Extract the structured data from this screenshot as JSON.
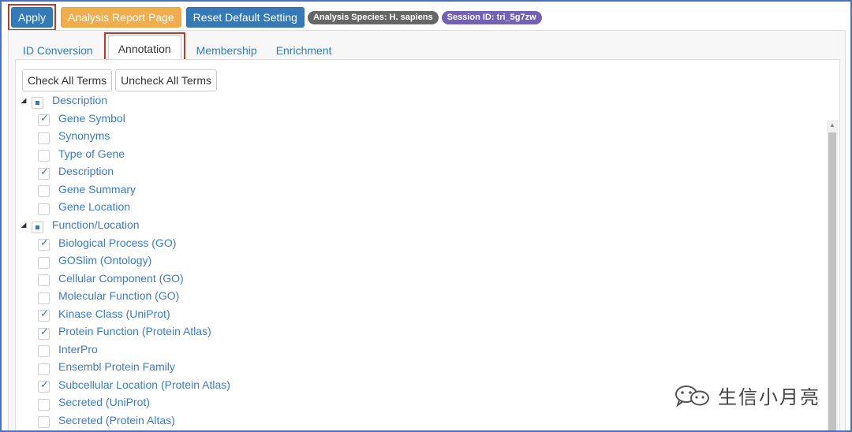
{
  "toolbar": {
    "apply_label": "Apply",
    "report_label": "Analysis Report Page",
    "reset_label": "Reset Default Setting",
    "species_badge": "Analysis Species: H. sapiens",
    "session_badge": "Session ID: tri_5g7zw"
  },
  "tabs": [
    {
      "label": "ID Conversion",
      "active": false
    },
    {
      "label": "Annotation",
      "active": true
    },
    {
      "label": "Membership",
      "active": false
    },
    {
      "label": "Enrichment",
      "active": false
    }
  ],
  "actions": {
    "check_all_label": "Check All Terms",
    "uncheck_all_label": "Uncheck All Terms"
  },
  "tree": [
    {
      "label": "Description",
      "state": "partial",
      "children": [
        {
          "label": "Gene Symbol",
          "checked": true
        },
        {
          "label": "Synonyms",
          "checked": false
        },
        {
          "label": "Type of Gene",
          "checked": false
        },
        {
          "label": "Description",
          "checked": true
        },
        {
          "label": "Gene Summary",
          "checked": false
        },
        {
          "label": "Gene Location",
          "checked": false
        }
      ]
    },
    {
      "label": "Function/Location",
      "state": "partial",
      "children": [
        {
          "label": "Biological Process (GO)",
          "checked": true
        },
        {
          "label": "GOSlim (Ontology)",
          "checked": false
        },
        {
          "label": "Cellular Component (GO)",
          "checked": false
        },
        {
          "label": "Molecular Function (GO)",
          "checked": false
        },
        {
          "label": "Kinase Class (UniProt)",
          "checked": true
        },
        {
          "label": "Protein Function (Protein Atlas)",
          "checked": true
        },
        {
          "label": "InterPro",
          "checked": false
        },
        {
          "label": "Ensembl Protein Family",
          "checked": false
        },
        {
          "label": "Subcellular Location (Protein Atlas)",
          "checked": true
        },
        {
          "label": "Secreted (UniProt)",
          "checked": false
        },
        {
          "label": "Secreted (Protein Altas)",
          "checked": false
        }
      ]
    }
  ],
  "watermark": {
    "text": "生信小月亮"
  }
}
